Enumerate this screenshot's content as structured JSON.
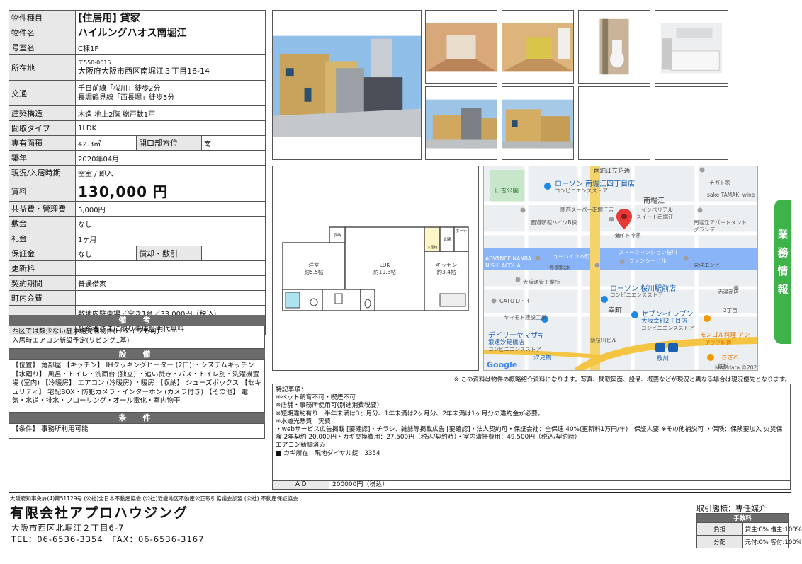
{
  "spec": {
    "type_label": "物件種目",
    "type_value": "[住居用] 貸家",
    "name_label": "物件名",
    "name_value": "ハイルングハオス南堀江",
    "room_label": "号室名",
    "room_value": "C棟1F",
    "addr_label": "所在地",
    "addr_zip": "〒550-0015",
    "addr_value": "大阪府大阪市西区南堀江３丁目16-14",
    "access_label": "交通",
    "access_line1": "千日前線「桜川」徒歩2分",
    "access_line2": "長堀鶴見線「西長堀」徒歩5分",
    "structure_label": "建築構造",
    "structure_value": "木造 地上2階 総戸数1戸",
    "layout_label": "間取タイプ",
    "layout_value": "1LDK",
    "area_label": "専有面積",
    "area_value": "42.3㎡",
    "dir_label": "開口部方位",
    "dir_value": "南",
    "built_label": "築年",
    "built_value": "2020年04月",
    "status_label": "現況/入居時期",
    "status_value": "空室 / 即入",
    "rent_label": "賃料",
    "rent_value": "130,000 円",
    "common_label": "共益費・管理費",
    "common_value": "5,000円",
    "deposit_label": "敷金",
    "deposit_value": "なし",
    "key_label": "礼金",
    "key_value": "1ヶ月",
    "guarantee_label": "保証金",
    "guarantee_value": "なし",
    "repay_label": "償却・敷引",
    "repay_value": "",
    "renew_label": "更新料",
    "renew_value": "",
    "contract_label": "契約期間",
    "contract_value": "普通借家",
    "town_label": "町内会費",
    "town_value": "",
    "parking_label": "駐車場",
    "parking_line1": "敷地内駐車場／空き1台／33,000円（税込）",
    "parking_line2": "契約者さまに限り車庫証明代無料"
  },
  "remarks": {
    "heading": "備　考",
    "text": "西区では数少ない駐車場完備物件(LLタイプも可)\n入居時エアコン新設予定(リビング1基)"
  },
  "equipment": {
    "heading": "設　備",
    "text": "【位置】 角部屋 【キッチン】 IHクッキングヒーター (2口) ・システムキッチン 【水廻り】 風呂・トイレ・洗面台 (独立) ・追い焚き・バス・トイレ別・洗濯機置場 (室内) 【冷暖房】 エアコン (冷暖房) ・暖房 【収納】 シューズボックス 【セキュリティ】 宅配BOX・防犯カメラ・インターホン (カメラ付き) 【その他】 電気・水道・排水・フローリング・オール電化・室内物干"
  },
  "conditions": {
    "heading": "条　件",
    "text": "【条件】 事務所利用可能"
  },
  "floorplan": {
    "room_western": "洋室",
    "room_western_size": "約5.5帖",
    "room_ldk": "LDK",
    "room_ldk_size": "約10.3帖",
    "room_kitchen": "キッチン",
    "room_kitchen_size": "約3.4帖",
    "storage": "収納",
    "porch": "ポーチ",
    "entrance": "玄関",
    "shoes": "下足箱"
  },
  "map": {
    "labels": [
      "南堀江立花通",
      "ローソン 南堀江四丁目店",
      "コンビニエンスストア",
      "日吉公園",
      "南堀江",
      "ナガト家",
      "sake TAMAKI wine",
      "関西スーパー南堀江店",
      "インペリアル",
      "スイート南堀江",
      "西道頓堀ハイツB棟",
      "南堀江アパートメント",
      "グランデ",
      "ダイト冷熱",
      "ニューハイツ本町",
      "ストークマンション桜川",
      "ADVANCE NANBA",
      "NISHI ACQUA",
      "長堀銘木",
      "ファンシービル",
      "東洋エンビ",
      "大阪通管工業所",
      "ローソン 桜川駅前店",
      "コンビニエンスストア",
      "赤湯商店",
      "GATO D・R",
      "幸町",
      "セブン-イレブン",
      "大阪幸町2丁目店",
      "コンビニエンスストア",
      "ヤマモト建設工業",
      "2丁目",
      "デイリーヤマザキ",
      "浪速汐見橋店",
      "コンビニエンスストア",
      "新桜川ビル",
      "モンゴル料理 アン",
      "アジア料理",
      "汐見橋",
      "桜川",
      "さざれ",
      "鉄板"
    ],
    "google": "Google",
    "mapdata": "Map data ©2023"
  },
  "side_tab": "業務情報",
  "note": "※ この資料は物件の概略紹介資料になります。写真、間取図面、設備、概要などが現況と異なる場合は現況優先となります。",
  "special": {
    "text": "特記事項：\n※ペット飼育不可・喫煙不可\n※店舗・事務所使用可(別途消費税要)\n※短期違約有り　半年未満は3ヶ月分、1年未満は2ヶ月分、2年未満は1ヶ月分の違約金が必要。\n※水道光熱費　実費\n・webサービス広告掲載 [要確認]・チラシ、雑誌等掲載広告 [要確認]・法人契約可・保証会社：全保連 40%(更新料1万円/年)　保証人要 ※その他補説可 ・保険：保険要加入 火災保険 2年契約 20,000円・カギ交換費用：27,500円（税込/契約時）・室内清掃費用：49,500円（税込/契約時）\nエアコン新調済み\n■ カギ所在：現地ダイヤル錠　3354"
  },
  "ad": {
    "label": "ＡＤ",
    "value": "200000円（税込）"
  },
  "footer": {
    "license": "大阪府知事免許(4)第51129号 (公社)全日本不動産協会 (公社)近畿地区不動産公正取引協議会加盟 (公社) 不動産保証協会",
    "company": "有限会社アプロハウジング",
    "address": "大阪市西区北堀江２丁目6-7",
    "tel": "TEL：06-6536-3354　FAX：06-6536-3167",
    "deal": "取引態様：専任媒介",
    "fee_heading": "手数料",
    "fee_burden_label": "負担",
    "fee_burden_value": "貸主:0%  借主:100%",
    "fee_split_label": "分配",
    "fee_split_value": "元付:0%  客付:100%"
  },
  "colors": {
    "header_gray": "#6b6b6b",
    "label_bg": "#e8e8e8",
    "tab_green": "#3db34a",
    "map_pin": "#e53935",
    "map_road_blue": "#5b9bd5"
  }
}
